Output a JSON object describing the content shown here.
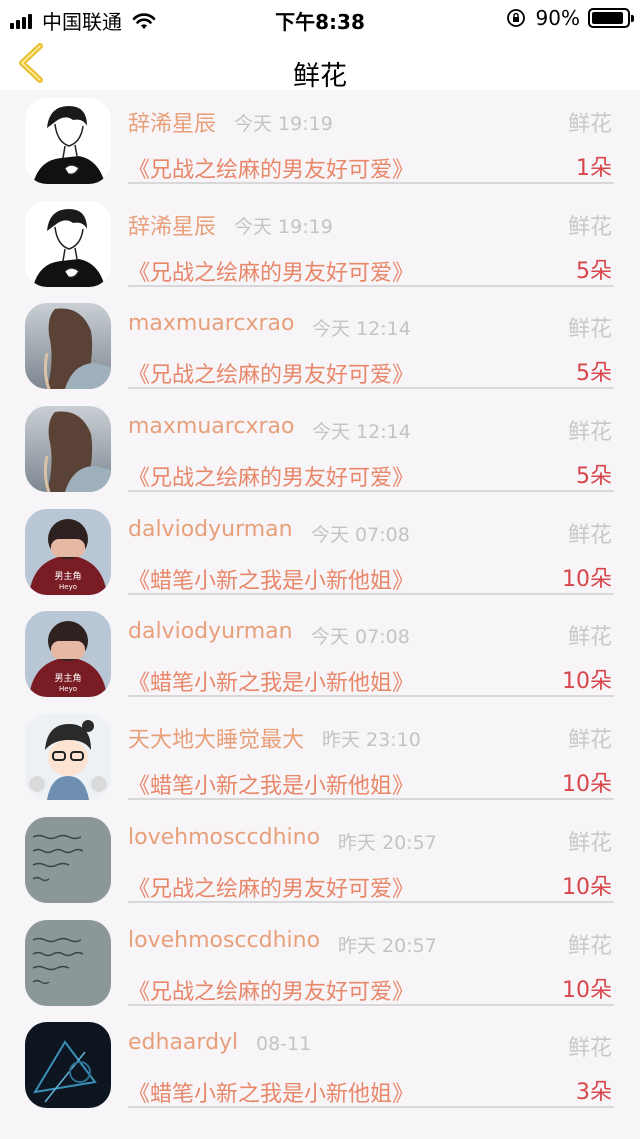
{
  "status_bar": {
    "carrier": "中国联通",
    "time": "下午8:38",
    "battery_pct": "90%",
    "battery_level": 0.9
  },
  "nav": {
    "title": "鲜花"
  },
  "rows": [
    {
      "name": "辞浠星辰",
      "time": "今天 19:19",
      "gift": "鲜花",
      "book": "《兄战之绘麻的男友好可爱》",
      "count": "1朵",
      "avatar": "sketch-man"
    },
    {
      "name": "辞浠星辰",
      "time": "今天 19:19",
      "gift": "鲜花",
      "book": "《兄战之绘麻的男友好可爱》",
      "count": "5朵",
      "avatar": "sketch-man"
    },
    {
      "name": "maxmuarcxrao",
      "time": "今天 12:14",
      "gift": "鲜花",
      "book": "《兄战之绘麻的男友好可爱》",
      "count": "5朵",
      "avatar": "girl-sea"
    },
    {
      "name": "maxmuarcxrao",
      "time": "今天 12:14",
      "gift": "鲜花",
      "book": "《兄战之绘麻的男友好可爱》",
      "count": "5朵",
      "avatar": "girl-sea"
    },
    {
      "name": "dalviodyurman",
      "time": "今天 07:08",
      "gift": "鲜花",
      "book": "《蜡笔小新之我是小新他姐》",
      "count": "10朵",
      "avatar": "boy-hoodie"
    },
    {
      "name": "dalviodyurman",
      "time": "今天 07:08",
      "gift": "鲜花",
      "book": "《蜡笔小新之我是小新他姐》",
      "count": "10朵",
      "avatar": "boy-hoodie"
    },
    {
      "name": "天大地大睡觉最大",
      "time": "昨天 23:10",
      "gift": "鲜花",
      "book": "《蜡笔小新之我是小新他姐》",
      "count": "10朵",
      "avatar": "cartoon-girl"
    },
    {
      "name": "lovehmosccdhino",
      "time": "昨天 20:57",
      "gift": "鲜花",
      "book": "《兄战之绘麻的男友好可爱》",
      "count": "10朵",
      "avatar": "handwriting"
    },
    {
      "name": "lovehmosccdhino",
      "time": "昨天 20:57",
      "gift": "鲜花",
      "book": "《兄战之绘麻的男友好可爱》",
      "count": "10朵",
      "avatar": "handwriting"
    },
    {
      "name": "edhaardyl",
      "time": "08-11",
      "gift": "鲜花",
      "book": "《蜡笔小新之我是小新他姐》",
      "count": "3朵",
      "avatar": "dark-abstract"
    }
  ],
  "hoodie_text": {
    "line1": "男主角",
    "line2": "Heyo"
  },
  "colors": {
    "name": "#e8a07b",
    "book": "#e8876a",
    "count": "#d8454b",
    "meta": "#c4c4c4",
    "back_arrow": "#f0c419"
  },
  "icons": {
    "back": "chevron-left-icon",
    "wifi": "wifi-icon",
    "lock": "orientation-lock-icon",
    "battery": "battery-icon"
  }
}
